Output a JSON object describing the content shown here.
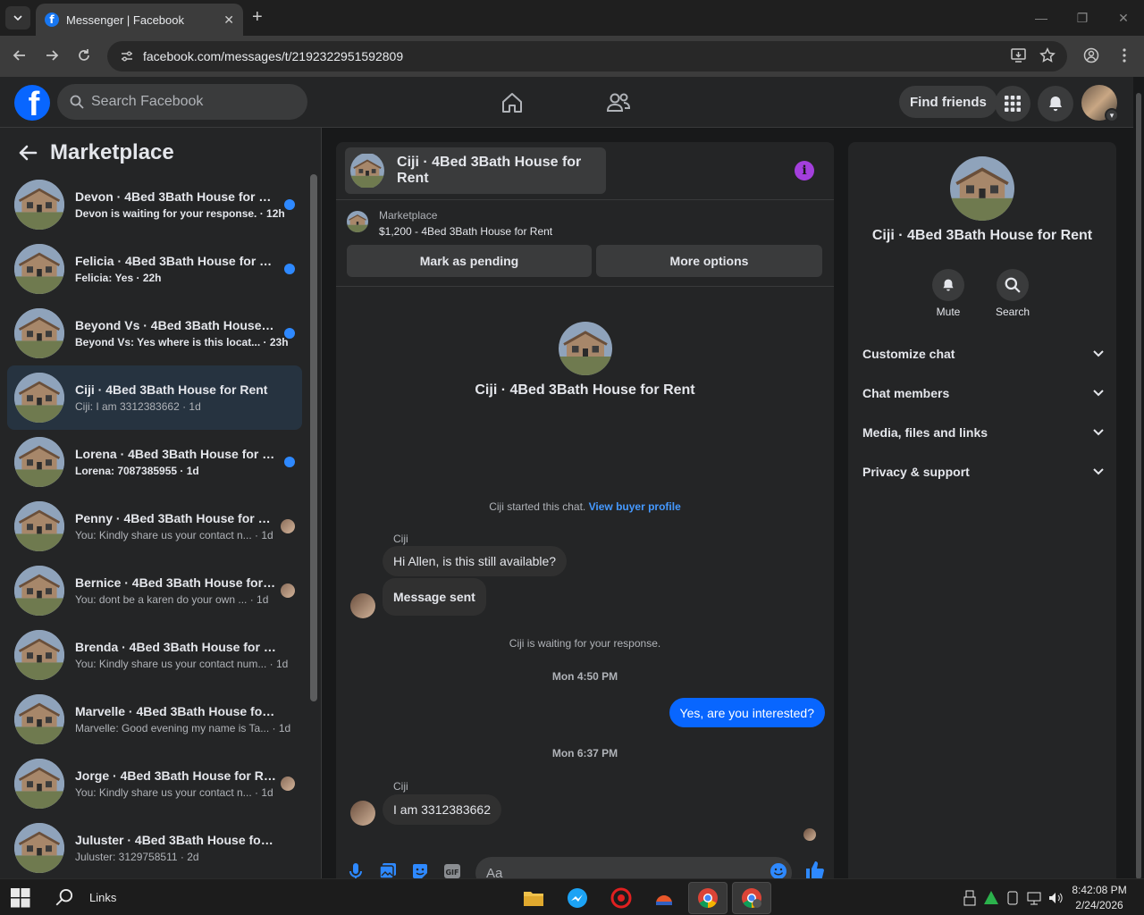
{
  "browser": {
    "tab_title": "Messenger | Facebook",
    "url": "facebook.com/messages/t/2192322951592809"
  },
  "fb_header": {
    "logo_letter": "f",
    "search_placeholder": "Search Facebook",
    "find_friends_label": "Find friends"
  },
  "left_pane": {
    "title": "Marketplace",
    "conversations": [
      {
        "name": "Devon · 4Bed 3Bath House for R...",
        "preview": "Devon is waiting for your response. · 12h",
        "unread": true
      },
      {
        "name": "Felicia · 4Bed 3Bath House for Re...",
        "preview": "Felicia: Yes · 22h",
        "unread": true
      },
      {
        "name": "Beyond Vs · 4Bed 3Bath House f...",
        "preview": "Beyond Vs: Yes where is this locat... · 23h",
        "unread": true
      },
      {
        "name": "Ciji · 4Bed 3Bath House for Rent",
        "preview": "Ciji: I am 3312383662 · 1d",
        "unread": false
      },
      {
        "name": "Lorena · 4Bed 3Bath House for R...",
        "preview": "Lorena: 7087385955 · 1d",
        "unread": true
      },
      {
        "name": "Penny · 4Bed 3Bath House for R...",
        "preview": "You: Kindly share us your contact n... · 1d",
        "unread": false
      },
      {
        "name": "Bernice · 4Bed 3Bath House for ...",
        "preview": "You: dont be a karen do your own ... · 1d",
        "unread": false
      },
      {
        "name": "Brenda · 4Bed 3Bath House for Rent",
        "preview": "You: Kindly share us your contact num... · 1d",
        "unread": false
      },
      {
        "name": "Marvelle · 4Bed 3Bath House for R...",
        "preview": "Marvelle: Good evening my name is Ta... · 1d",
        "unread": false
      },
      {
        "name": "Jorge · 4Bed 3Bath House for Re...",
        "preview": "You: Kindly share us your contact n... · 1d",
        "unread": false
      },
      {
        "name": "Juluster · 4Bed 3Bath House for Rent",
        "preview": "Juluster: 3129758511 · 2d",
        "unread": false
      }
    ]
  },
  "chat": {
    "header_title": "Ciji · 4Bed 3Bath House for Rent",
    "marketplace_label": "Marketplace",
    "listing": "$1,200 - 4Bed 3Bath House for Rent",
    "mark_pending_label": "Mark as pending",
    "more_options_label": "More options",
    "intro_name": "Ciji · 4Bed 3Bath House for Rent",
    "started_text": "Ciji started this chat.",
    "view_profile_link": "View buyer profile",
    "sender_name": "Ciji",
    "msg1": "Hi Allen, is this still available?",
    "msg2": "Message sent",
    "waiting_text": "Ciji is waiting for your response.",
    "stamp1": "Mon 4:50 PM",
    "my_msg": "Yes, are you interested?",
    "stamp2": "Mon 6:37 PM",
    "msg3": "I am 3312383662",
    "composer_placeholder": "Aa"
  },
  "info_pane": {
    "name": "Ciji · 4Bed 3Bath House for Rent",
    "mute_label": "Mute",
    "search_label": "Search",
    "rows": [
      "Customize chat",
      "Chat members",
      "Media, files and links",
      "Privacy & support"
    ]
  },
  "taskbar": {
    "links_label": "Links",
    "time": "8:42:08 PM",
    "date": "2/24/2026"
  },
  "colors": {
    "accent": "#0866ff",
    "unread_dot": "#2e89ff",
    "info_icon": "#a33fdc"
  }
}
